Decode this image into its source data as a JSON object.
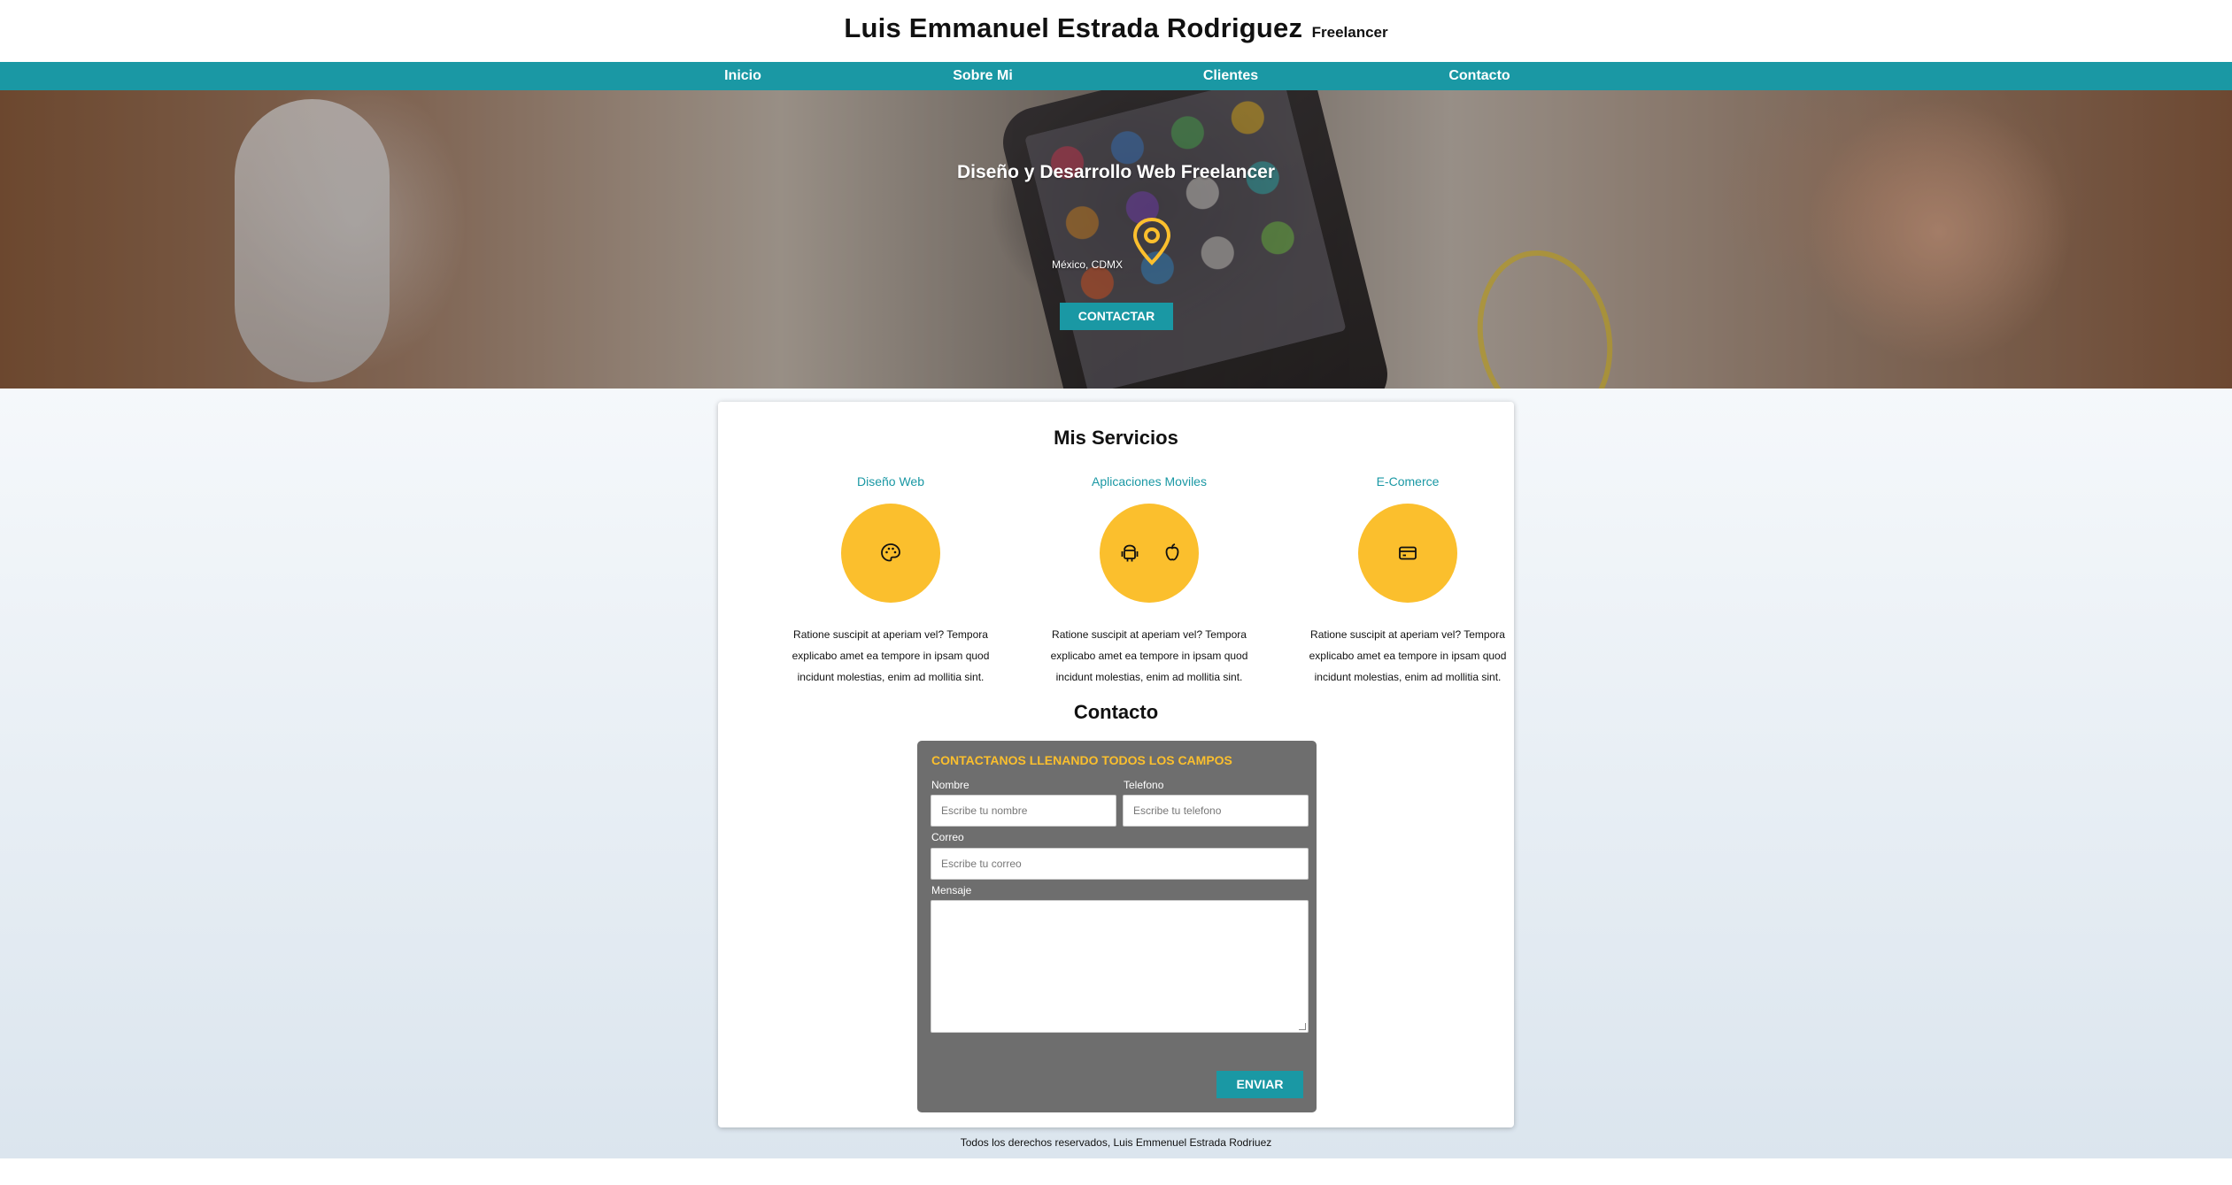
{
  "header": {
    "name": "Luis Emmanuel Estrada Rodriguez",
    "role": "Freelancer"
  },
  "nav": {
    "items": [
      {
        "label": "Inicio"
      },
      {
        "label": "Sobre Mi"
      },
      {
        "label": "Clientes"
      },
      {
        "label": "Contacto"
      }
    ]
  },
  "hero": {
    "title": "Diseño y Desarrollo Web Freelancer",
    "location_icon": "map-pin-icon",
    "location": "México, CDMX",
    "button_label": "CONTACTAR"
  },
  "services": {
    "title": "Mis Servicios",
    "items": [
      {
        "name": "Diseño Web",
        "icon": "palette-icon",
        "description": "Ratione suscipit at aperiam vel? Tempora explicabo amet ea tempore in ipsam quod incidunt molestias, enim ad mollitia sint."
      },
      {
        "name": "Aplicaciones Moviles",
        "icon": "android-icon, apple-icon",
        "description": "Ratione suscipit at aperiam vel? Tempora explicabo amet ea tempore in ipsam quod incidunt molestias, enim ad mollitia sint."
      },
      {
        "name": "E-Comerce",
        "icon": "credit-card-icon",
        "description": "Ratione suscipit at aperiam vel? Tempora explicabo amet ea tempore in ipsam quod incidunt molestias, enim ad mollitia sint."
      }
    ]
  },
  "contact": {
    "title": "Contacto",
    "form_heading": "CONTACTANOS LLENANDO TODOS LOS CAMPOS",
    "name_label": "Nombre",
    "name_placeholder": "Escribe tu nombre",
    "phone_label": "Telefono",
    "phone_placeholder": "Escribe tu telefono",
    "email_label": "Correo",
    "email_placeholder": "Escribe tu correo",
    "message_label": "Mensaje",
    "submit_label": "ENVIAR"
  },
  "footer": {
    "text": "Todos los derechos reservados, Luis Emmenuel Estrada Rodriuez"
  },
  "colors": {
    "accent": "#1a98a4",
    "highlight": "#fbbf2d",
    "form_bg": "#6e6e6e"
  }
}
